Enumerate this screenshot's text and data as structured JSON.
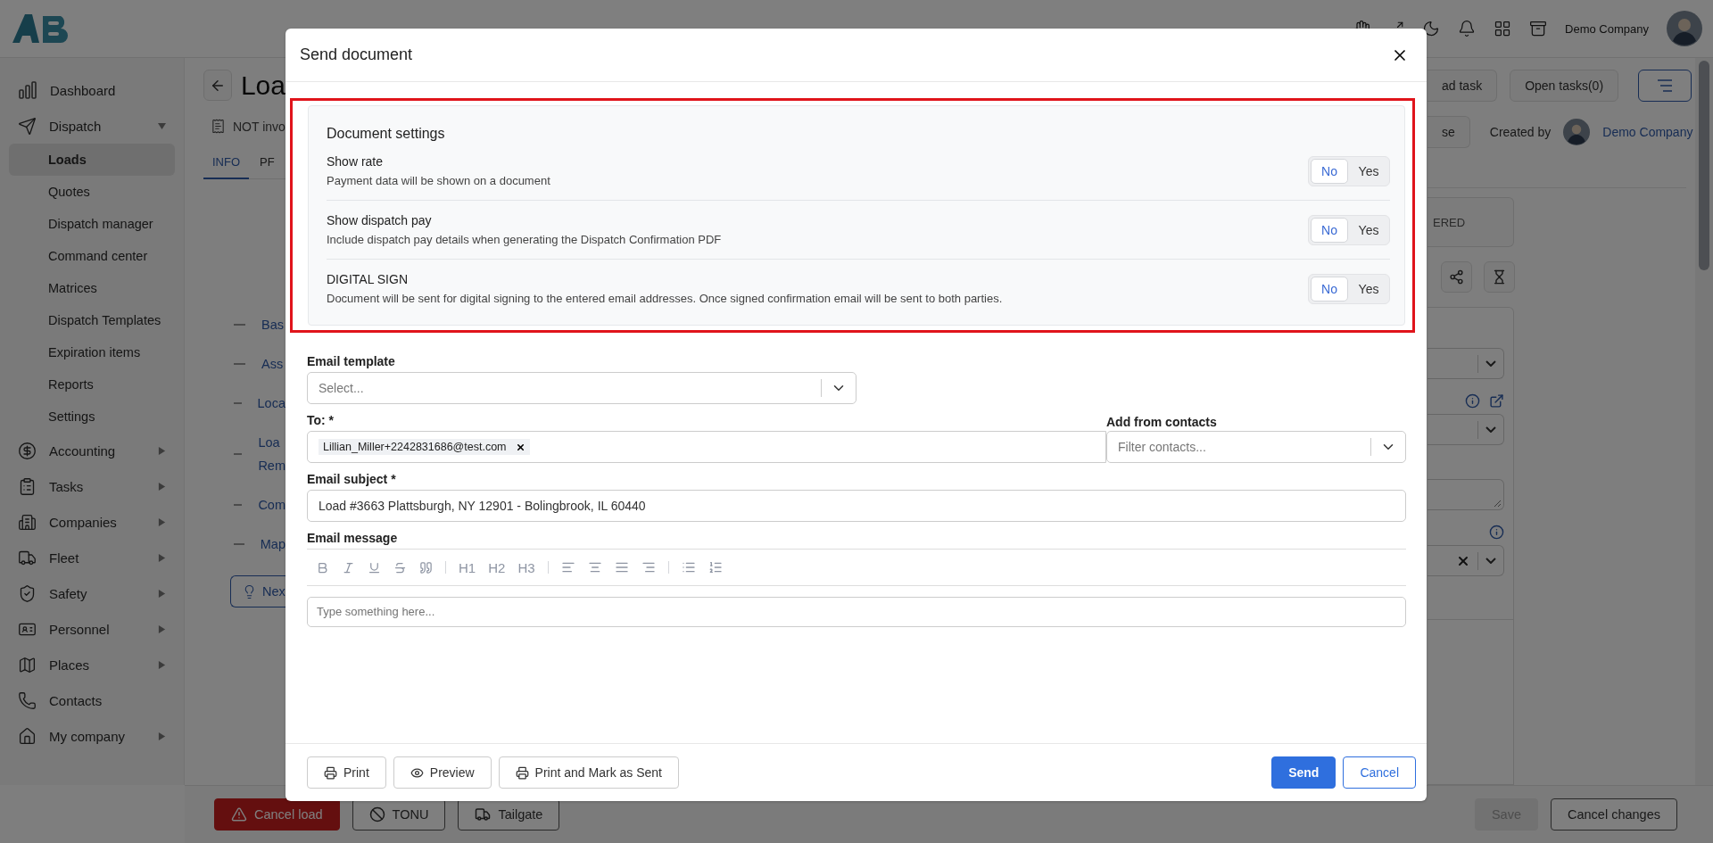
{
  "header": {
    "company": "Demo Company"
  },
  "sidebar": {
    "items": [
      {
        "label": "Dashboard",
        "kind": "link"
      },
      {
        "label": "Dispatch",
        "kind": "group",
        "expanded": true,
        "children": [
          {
            "label": "Loads",
            "selected": true
          },
          {
            "label": "Quotes",
            "selected": false
          },
          {
            "label": "Dispatch manager",
            "selected": false
          },
          {
            "label": "Command center",
            "selected": false
          },
          {
            "label": "Matrices",
            "selected": false
          },
          {
            "label": "Dispatch Templates",
            "selected": false
          },
          {
            "label": "Expiration items",
            "selected": false
          },
          {
            "label": "Reports",
            "selected": false
          },
          {
            "label": "Settings",
            "selected": false
          }
        ]
      },
      {
        "label": "Accounting",
        "kind": "group",
        "expanded": false
      },
      {
        "label": "Tasks",
        "kind": "group",
        "expanded": false
      },
      {
        "label": "Companies",
        "kind": "group",
        "expanded": false
      },
      {
        "label": "Fleet",
        "kind": "group",
        "expanded": false
      },
      {
        "label": "Safety",
        "kind": "group",
        "expanded": false
      },
      {
        "label": "Personnel",
        "kind": "group",
        "expanded": false
      },
      {
        "label": "Places",
        "kind": "group",
        "expanded": false
      },
      {
        "label": "Contacts",
        "kind": "link"
      },
      {
        "label": "My company",
        "kind": "group",
        "expanded": false
      }
    ]
  },
  "page": {
    "title": "Loa",
    "invoice_status": "NOT invo",
    "tabs": [
      {
        "label": "INFO",
        "selected": true
      },
      {
        "label": "PF",
        "selected": false
      }
    ],
    "sections": [
      {
        "lines": [
          "Bas"
        ]
      },
      {
        "lines": [
          "Ass"
        ]
      },
      {
        "lines": [
          "Loca"
        ]
      },
      {
        "lines": [
          "Loa",
          "Rem"
        ]
      },
      {
        "lines": [
          "Com"
        ]
      },
      {
        "lines": [
          "Map"
        ]
      }
    ],
    "next_button": "Nex",
    "actions": {
      "add_task": "ad task",
      "open_tasks": "Open tasks(0)",
      "close": "se"
    },
    "created_by": {
      "label": "Created by",
      "name": "Demo Company"
    },
    "status": "ERED"
  },
  "bottom_bar": {
    "left": [
      {
        "label": "Cancel load",
        "kind": "danger"
      },
      {
        "label": "TONU",
        "kind": "outline"
      },
      {
        "label": "Tailgate",
        "kind": "outline"
      }
    ],
    "right": [
      {
        "label": "Save",
        "disabled": true
      },
      {
        "label": "Cancel changes",
        "disabled": false
      }
    ]
  },
  "modal": {
    "title": "Send document",
    "settings": {
      "highlighted": true,
      "title": "Document settings",
      "rows": [
        {
          "label": "Show rate",
          "description": "Payment data will be shown on a document",
          "options": [
            "No",
            "Yes"
          ],
          "on": false
        },
        {
          "label": "Show dispatch pay",
          "description": "Include dispatch pay details when generating the Dispatch Confirmation PDF",
          "options": [
            "No",
            "Yes"
          ],
          "on": false
        },
        {
          "label": "DIGITAL SIGN",
          "description": "Document will be sent for digital signing to the entered email addresses. Once signed confirmation email will be sent to both parties.",
          "options": [
            "No",
            "Yes"
          ],
          "on": false
        }
      ]
    },
    "form": {
      "template": {
        "label": "Email template",
        "placeholder": "Select..."
      },
      "to": {
        "label": "To: *",
        "chips": [
          "Lillian_Miller+2242831686@test.com"
        ]
      },
      "contacts": {
        "label": "Add from contacts",
        "placeholder": "Filter contacts..."
      },
      "subject": {
        "label": "Email subject *",
        "value": "Load #3663 Plattsburgh, NY 12901 - Bolingbrook, IL 60440"
      },
      "message": {
        "label": "Email message",
        "headings": [
          "H1",
          "H2",
          "H3"
        ],
        "placeholder": "Type something here..."
      }
    },
    "footer": {
      "left": [
        {
          "label": "Print",
          "kind": "print"
        },
        {
          "label": "Preview",
          "kind": "preview"
        },
        {
          "label": "Print and Mark as Sent",
          "kind": "print"
        }
      ],
      "right": [
        {
          "label": "Send",
          "kind": "primary"
        },
        {
          "label": "Cancel",
          "kind": "outline"
        }
      ]
    }
  }
}
